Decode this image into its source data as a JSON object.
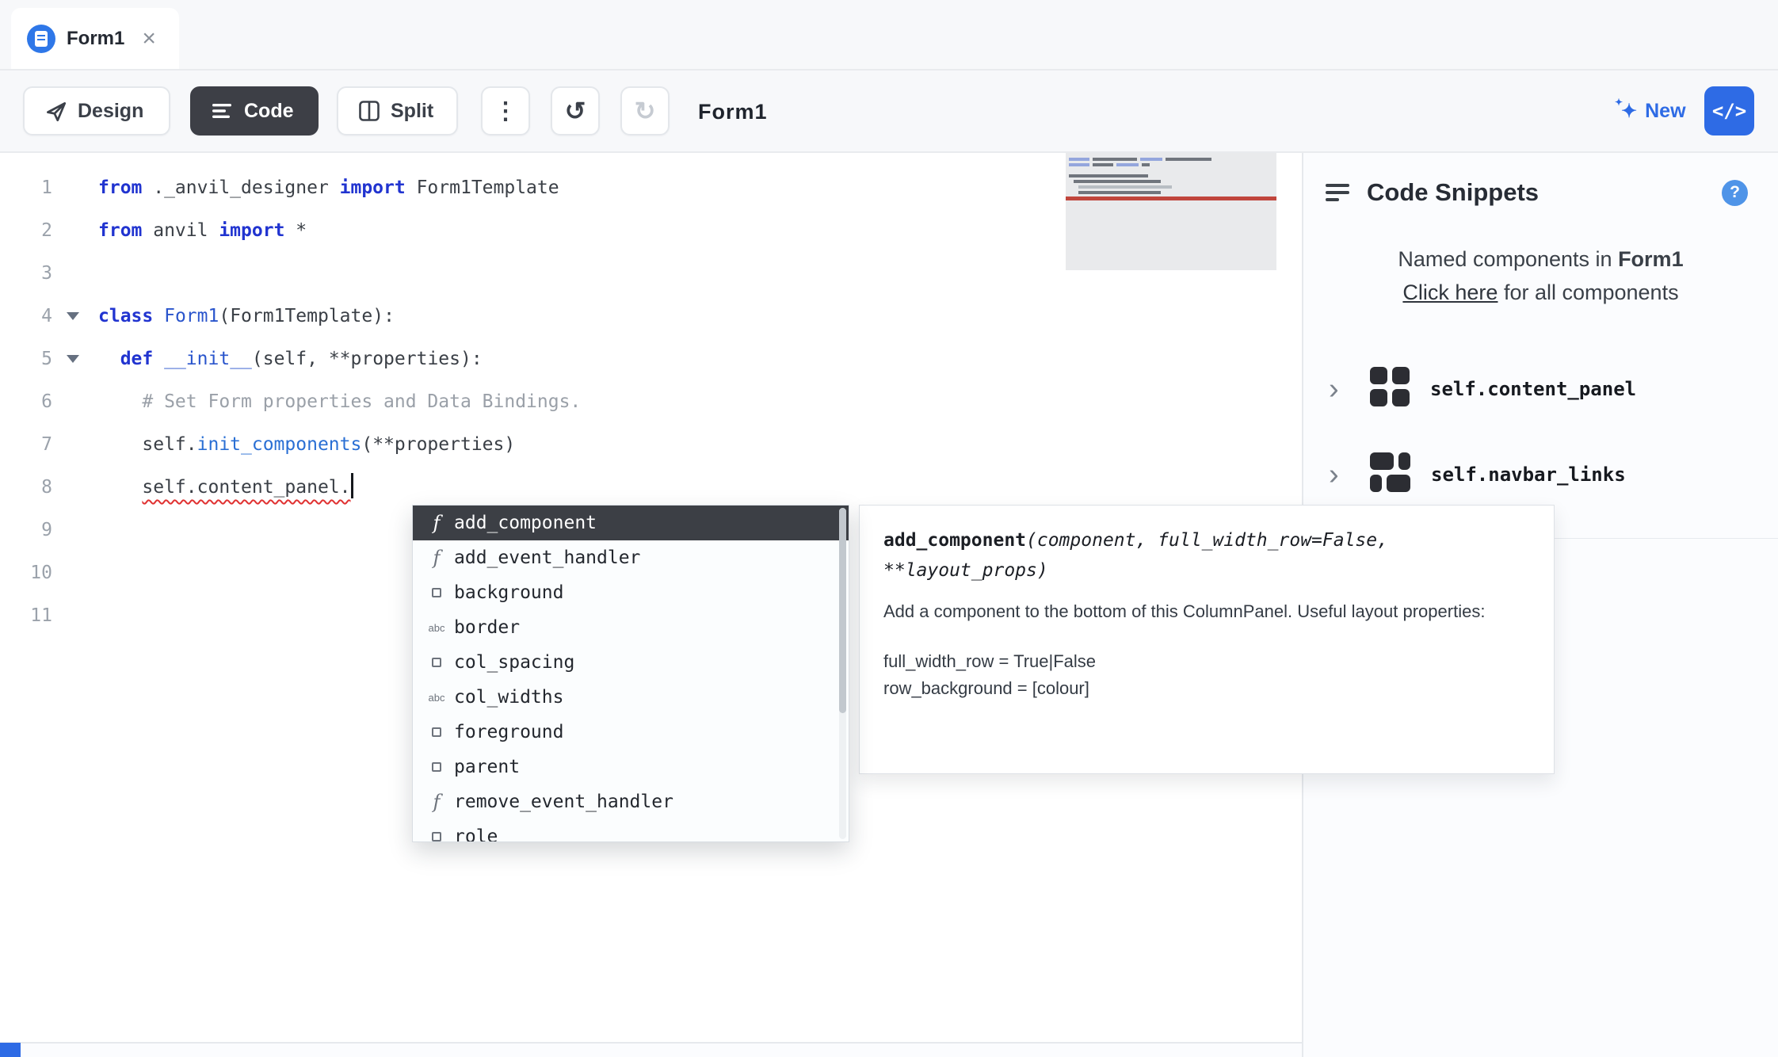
{
  "tab_bar": {
    "tab_title": "Form1",
    "close_label": "×"
  },
  "toolbar": {
    "design": "Design",
    "code": "Code",
    "split": "Split",
    "kebab": "⋮",
    "undo": "↺",
    "redo": "↻",
    "form_title": "Form1",
    "new": "New",
    "sparkle": "✦",
    "code_toggle": "</>"
  },
  "editor": {
    "line_numbers": [
      "1",
      "2",
      "3",
      "4",
      "5",
      "6",
      "7",
      "8",
      "9",
      "10",
      "11"
    ],
    "foldable_lines": [
      4,
      5
    ],
    "lines": [
      {
        "num": 1,
        "tokens": [
          [
            "kw",
            "from"
          ],
          [
            "plain",
            " ._anvil_designer "
          ],
          [
            "kw",
            "import"
          ],
          [
            "plain",
            " Form1Template"
          ]
        ]
      },
      {
        "num": 2,
        "tokens": [
          [
            "kw",
            "from"
          ],
          [
            "plain",
            " anvil "
          ],
          [
            "kw",
            "import"
          ],
          [
            "plain",
            " *"
          ]
        ]
      },
      {
        "num": 3,
        "tokens": []
      },
      {
        "num": 4,
        "tokens": [
          [
            "kw",
            "class"
          ],
          [
            "plain",
            " "
          ],
          [
            "name",
            "Form1"
          ],
          [
            "plain",
            "(Form1Template):"
          ]
        ]
      },
      {
        "num": 5,
        "tokens": [
          [
            "plain",
            "  "
          ],
          [
            "kw",
            "def"
          ],
          [
            "plain",
            " "
          ],
          [
            "name",
            "__init__"
          ],
          [
            "plain",
            "(self, **properties):"
          ]
        ]
      },
      {
        "num": 6,
        "tokens": [
          [
            "comment",
            "    # Set Form properties and Data Bindings."
          ]
        ]
      },
      {
        "num": 7,
        "tokens": [
          [
            "plain",
            "    self."
          ],
          [
            "fn",
            "init_components"
          ],
          [
            "plain",
            "(**properties)"
          ]
        ]
      },
      {
        "num": 8,
        "tokens": [
          [
            "plain",
            "    "
          ],
          [
            "error",
            "self.content_panel."
          ],
          [
            "cursor",
            ""
          ]
        ]
      },
      {
        "num": 9,
        "tokens": []
      },
      {
        "num": 10,
        "tokens": []
      },
      {
        "num": 11,
        "tokens": []
      }
    ]
  },
  "autocomplete": {
    "items": [
      {
        "label": "add_component",
        "kind": "function",
        "selected": true
      },
      {
        "label": "add_event_handler",
        "kind": "function",
        "selected": false
      },
      {
        "label": "background",
        "kind": "property",
        "selected": false
      },
      {
        "label": "border",
        "kind": "text",
        "selected": false
      },
      {
        "label": "col_spacing",
        "kind": "property",
        "selected": false
      },
      {
        "label": "col_widths",
        "kind": "text",
        "selected": false
      },
      {
        "label": "foreground",
        "kind": "property",
        "selected": false
      },
      {
        "label": "parent",
        "kind": "property",
        "selected": false
      },
      {
        "label": "remove_event_handler",
        "kind": "function",
        "selected": false
      },
      {
        "label": "role",
        "kind": "property",
        "selected": false
      }
    ],
    "text_icon_label": "abc",
    "function_icon_label": "f"
  },
  "doc_tooltip": {
    "name": "add_component",
    "params": "(component, full_width_row=False, **layout_props)",
    "description": "Add a component to the bottom of this ColumnPanel. Useful layout properties:",
    "prop_lines": [
      "full_width_row = True|False",
      "row_background = [colour]"
    ]
  },
  "snippets": {
    "title": "Code Snippets",
    "help": "?",
    "named_prefix": "Named components in ",
    "named_form": "Form1",
    "link": "Click here",
    "link_suffix": " for all components",
    "chevron": "›",
    "components": [
      {
        "name": "self.content_panel"
      },
      {
        "name": "self.navbar_links"
      }
    ]
  },
  "colors": {
    "accent_blue": "#2e6be5",
    "dark_button": "#3d3f46",
    "keyword_blue": "#2134d0",
    "comment_gray": "#9aa0a8",
    "error_red": "#e03131",
    "selected_item_bg": "#3c3f45"
  }
}
